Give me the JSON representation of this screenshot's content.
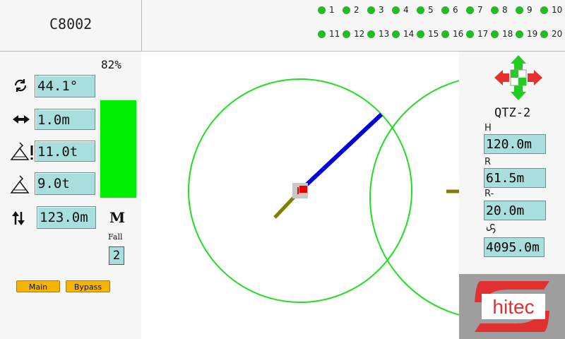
{
  "header": {
    "model": "C8002"
  },
  "status_lights": [
    {
      "label": "1"
    },
    {
      "label": "2"
    },
    {
      "label": "3"
    },
    {
      "label": "4"
    },
    {
      "label": "5"
    },
    {
      "label": "6"
    },
    {
      "label": "7"
    },
    {
      "label": "8"
    },
    {
      "label": "9"
    },
    {
      "label": "10"
    },
    {
      "label": "11"
    },
    {
      "label": "12"
    },
    {
      "label": "13"
    },
    {
      "label": "14"
    },
    {
      "label": "15"
    },
    {
      "label": "16"
    },
    {
      "label": "17"
    },
    {
      "label": "18"
    },
    {
      "label": "19"
    },
    {
      "label": "20"
    }
  ],
  "readings": {
    "slew_angle": "44.1°",
    "trolley_radius": "1.0m",
    "max_load": "11.0t",
    "current_load": "9.0t",
    "hook_height": "123.0m"
  },
  "load_ratio": {
    "percent_label": "82%",
    "percent": 82
  },
  "fall": {
    "mode_label": "M",
    "label": "Fall",
    "value": "2"
  },
  "buttons": {
    "main": "Main",
    "bypass": "Bypass"
  },
  "crane_id": "QTZ-2",
  "parameters": {
    "height_label": "H",
    "height_value": "120.0m",
    "radius_label": "R",
    "radius_value": "61.5m",
    "rear_radius_label": "R-",
    "rear_radius_value": "20.0m",
    "wind_value": "4095.0m"
  },
  "brand": {
    "logo_text": "hitec"
  },
  "colors": {
    "status_light": "#22bb22",
    "load_bar": "#00ee00",
    "jib": "#0000dd",
    "counter_jib": "#808000",
    "work_circle": "#22dd22",
    "trolley": "#ee0000",
    "value_box": "#a9dede",
    "button": "#f4b400",
    "logo": "#e03030"
  },
  "icons": [
    "rotate-icon",
    "trolley-arrows-icon",
    "max-load-warning-icon",
    "load-hook-icon",
    "height-arrows-icon",
    "direction-cross-icon",
    "wind-icon",
    "hitec-logo"
  ]
}
